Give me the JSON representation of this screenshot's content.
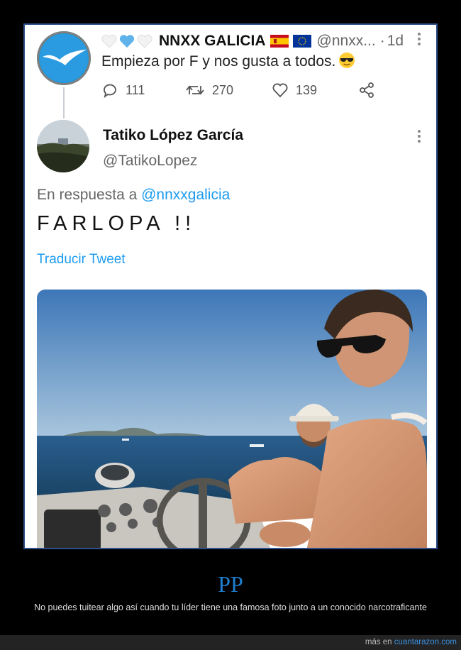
{
  "tweet": {
    "author_name": "NNXX GALICIA",
    "author_handle": "@nnxx...",
    "dot": "·",
    "time": "1d",
    "text": "Empieza por F y nos gusta a todos.",
    "stats": {
      "replies": "111",
      "retweets": "270",
      "likes": "139"
    },
    "icons": {
      "hearts": [
        "white-heart-icon",
        "blue-heart-icon",
        "white-heart-icon"
      ],
      "flags": [
        "spain-flag-icon",
        "eu-flag-icon"
      ],
      "emoji": "sunglasses-emoji-icon"
    }
  },
  "reply": {
    "author_name": "Tatiko López García",
    "author_handle": "@TatikoLopez",
    "reply_prefix": "En respuesta a",
    "reply_mention": "@nnxxgalicia",
    "text": "FARLOPA !!",
    "translate_label": "Traducir Tweet"
  },
  "footer": {
    "title": "PP",
    "description": "No puedes tuitear algo así cuando tu líder tiene una famosa foto junto a un conocido narcotraficante",
    "credit_prefix": "más en",
    "credit_site": "cuantarazon.com"
  },
  "colors": {
    "accent_blue": "#1d9bf0",
    "frame_border": "#2f4f8a",
    "footer_title": "#1e7fd0"
  }
}
